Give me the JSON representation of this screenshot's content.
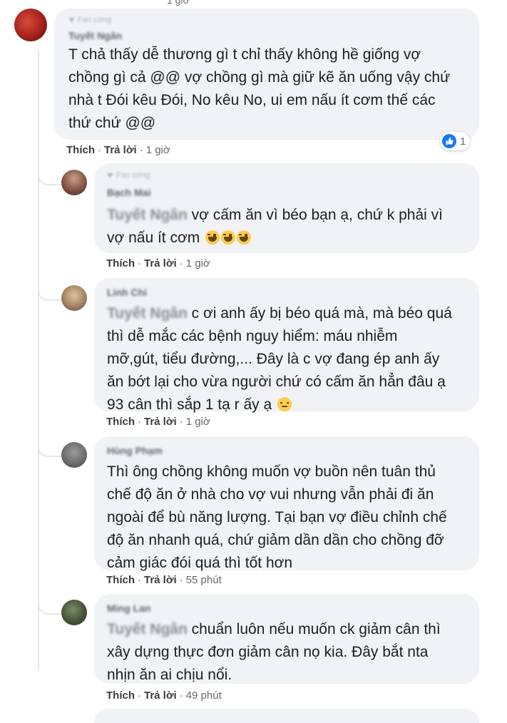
{
  "colors": {
    "bubble": "#f0f2f5",
    "like_blue": "#1877f2",
    "meta_gray": "#65676b"
  },
  "top_bar": {
    "fan_badge": "Fan cứng",
    "timestamp": ""
  },
  "comments": [
    {
      "fan_badge": "Fan cứng",
      "author": "Tuyết Ngân",
      "text": "T chả thấy dễ thương gì t chỉ thấy không hề giống vợ\nchồng gì cả @@ vợ chồng gì mà giữ kẽ ăn uống vậy chứ\nnhà t Đói kêu Đói, No kêu No, ui em nấu ít cơm thế các\nthứ chứ @@",
      "like": "Thích",
      "reply": "Trả lời",
      "time": "1 giờ",
      "reaction_count": "1",
      "reaction_icon": "like-icon"
    },
    {
      "fan_badge": "Fan cứng",
      "author": "Bạch Mai",
      "tag": "Tuyết Ngân",
      "text_first": " vợ cấm ăn vì béo bạn ạ, chứ k phải vì",
      "text_rest": "vợ nấu ít cơm ",
      "emojis": [
        "laughing-tears-emoji",
        "laughing-tears-emoji",
        "laughing-tears-emoji"
      ],
      "like": "Thích",
      "reply": "Trả lời",
      "time": "1 giờ"
    },
    {
      "author": "Linh Chi",
      "tag": "Tuyết Ngân",
      "text_first": " c ơi anh ấy bị béo quá mà, mà béo quá",
      "text_rest": "thì dễ mắc các bệnh nguy hiểm: máu nhiễm\nmỡ,gút, tiểu đường,... Đây là c vợ đang ép anh ấy\năn bớt lại cho vừa người chứ có cấm ăn hẳn đâu ạ\n93 cân thì sắp 1 tạ r ấy ạ ",
      "emoji": "disappointed-emoji",
      "like": "Thích",
      "reply": "Trả lời",
      "time": "1 giờ"
    },
    {
      "author": "Hùng Phạm",
      "text": "Thì ông chồng không muốn vợ buồn nên tuân thủ\nchế độ ăn ở nhà cho vợ vui nhưng vẫn phải đi ăn\nngoài để bù năng lượng. Tại bạn vợ điều chỉnh chế\nđộ ăn nhanh quá, chứ giảm dần dần cho chồng đỡ\ncảm giác đói quá thì tốt hơn",
      "like": "Thích",
      "reply": "Trả lời",
      "time": "55 phút"
    },
    {
      "author": "Ming Lan",
      "tag": "Tuyết Ngân",
      "text_first": " chuẩn luôn nếu muốn ck giảm cân thì",
      "text_rest": "xây dựng thực đơn giảm cân nọ kia. Đây bắt nta\nnhịn ăn ai chịu nổi.",
      "like": "Thích",
      "reply": "Trả lời",
      "time": "49 phút"
    }
  ]
}
